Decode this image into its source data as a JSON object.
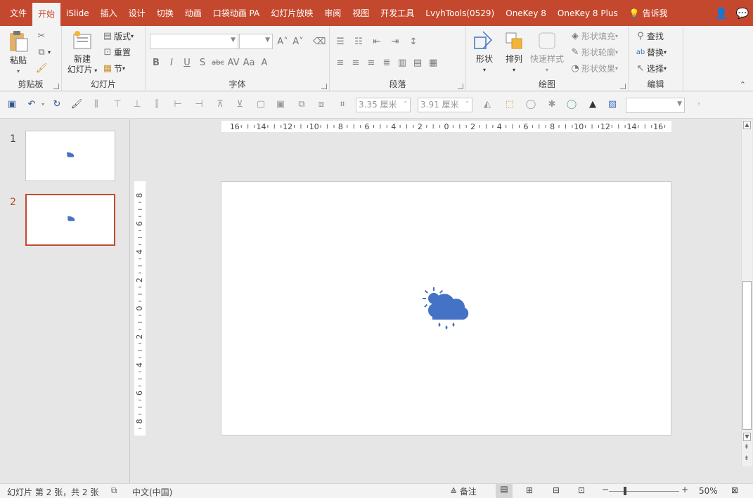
{
  "tabs": [
    "文件",
    "开始",
    "iSlide",
    "插入",
    "设计",
    "切换",
    "动画",
    "口袋动画 PA",
    "幻灯片放映",
    "审阅",
    "视图",
    "开发工具",
    "LvyhTools(0529)",
    "OneKey 8",
    "OneKey 8 Plus"
  ],
  "active_tab_index": 1,
  "tell_me": "告诉我",
  "ribbon": {
    "clipboard": {
      "label": "剪贴板",
      "paste": "粘贴"
    },
    "slides": {
      "label": "幻灯片",
      "new_slide_line1": "新建",
      "new_slide_line2": "幻灯片",
      "layout": "版式",
      "reset": "重置",
      "section": "节"
    },
    "font": {
      "label": "字体"
    },
    "paragraph": {
      "label": "段落"
    },
    "drawing": {
      "label": "绘图",
      "shape": "形状",
      "arrange": "排列",
      "quick_styles": "快速样式",
      "shape_fill": "形状填充",
      "shape_outline": "形状轮廓",
      "shape_effects": "形状效果"
    },
    "editing": {
      "label": "编辑",
      "find": "查找",
      "replace": "替换",
      "select": "选择"
    }
  },
  "qat": {
    "height_value": "3.35 厘米",
    "width_value": "3.91 厘米"
  },
  "ruler": {
    "h_ticks": [
      "16",
      "14",
      "12",
      "10",
      "8",
      "6",
      "4",
      "2",
      "0",
      "2",
      "4",
      "6",
      "8",
      "10",
      "12",
      "14",
      "16"
    ],
    "v_ticks": [
      "8",
      "6",
      "4",
      "2",
      "0",
      "2",
      "4",
      "6",
      "8"
    ]
  },
  "slides": [
    {
      "number": "1",
      "selected": false
    },
    {
      "number": "2",
      "selected": true
    }
  ],
  "colors": {
    "accent": "#c4482e",
    "icon_blue": "#4472c4"
  },
  "status": {
    "slide_info": "幻灯片 第 2 张，共 2 张",
    "language": "中文(中国)",
    "notes": "备注",
    "zoom": "50%"
  }
}
